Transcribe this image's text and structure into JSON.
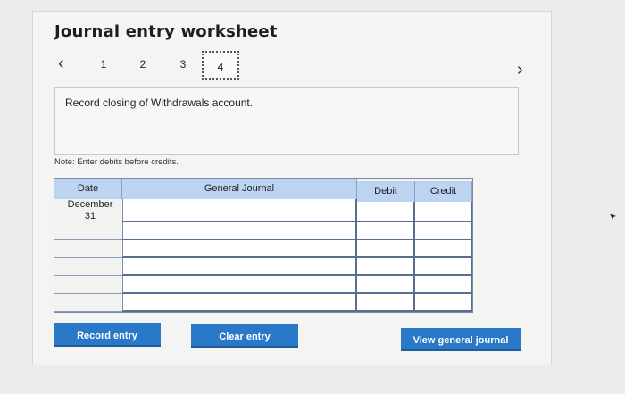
{
  "worksheet": {
    "title": "Journal entry worksheet",
    "steps": [
      "1",
      "2",
      "3",
      "4"
    ],
    "active_step": "4",
    "instruction": "Record closing of Withdrawals account.",
    "note": "Note: Enter debits before credits."
  },
  "table": {
    "headers": {
      "date": "Date",
      "general_journal": "General Journal",
      "debit": "Debit",
      "credit": "Credit"
    },
    "rows": [
      {
        "date_line1": "December",
        "date_line2": "31",
        "account": "",
        "debit": "",
        "credit": ""
      },
      {
        "date_line1": "",
        "date_line2": "",
        "account": "",
        "debit": "",
        "credit": ""
      },
      {
        "date_line1": "",
        "date_line2": "",
        "account": "",
        "debit": "",
        "credit": ""
      },
      {
        "date_line1": "",
        "date_line2": "",
        "account": "",
        "debit": "",
        "credit": ""
      },
      {
        "date_line1": "",
        "date_line2": "",
        "account": "",
        "debit": "",
        "credit": ""
      },
      {
        "date_line1": "",
        "date_line2": "",
        "account": "",
        "debit": "",
        "credit": ""
      }
    ]
  },
  "buttons": {
    "record": "Record entry",
    "clear": "Clear entry",
    "view": "View general journal"
  },
  "colors": {
    "accent": "#2a79c8",
    "header_bg": "#bcd3f2"
  },
  "icons": {
    "prev": "chevron-left-icon",
    "next": "chevron-right-icon"
  }
}
